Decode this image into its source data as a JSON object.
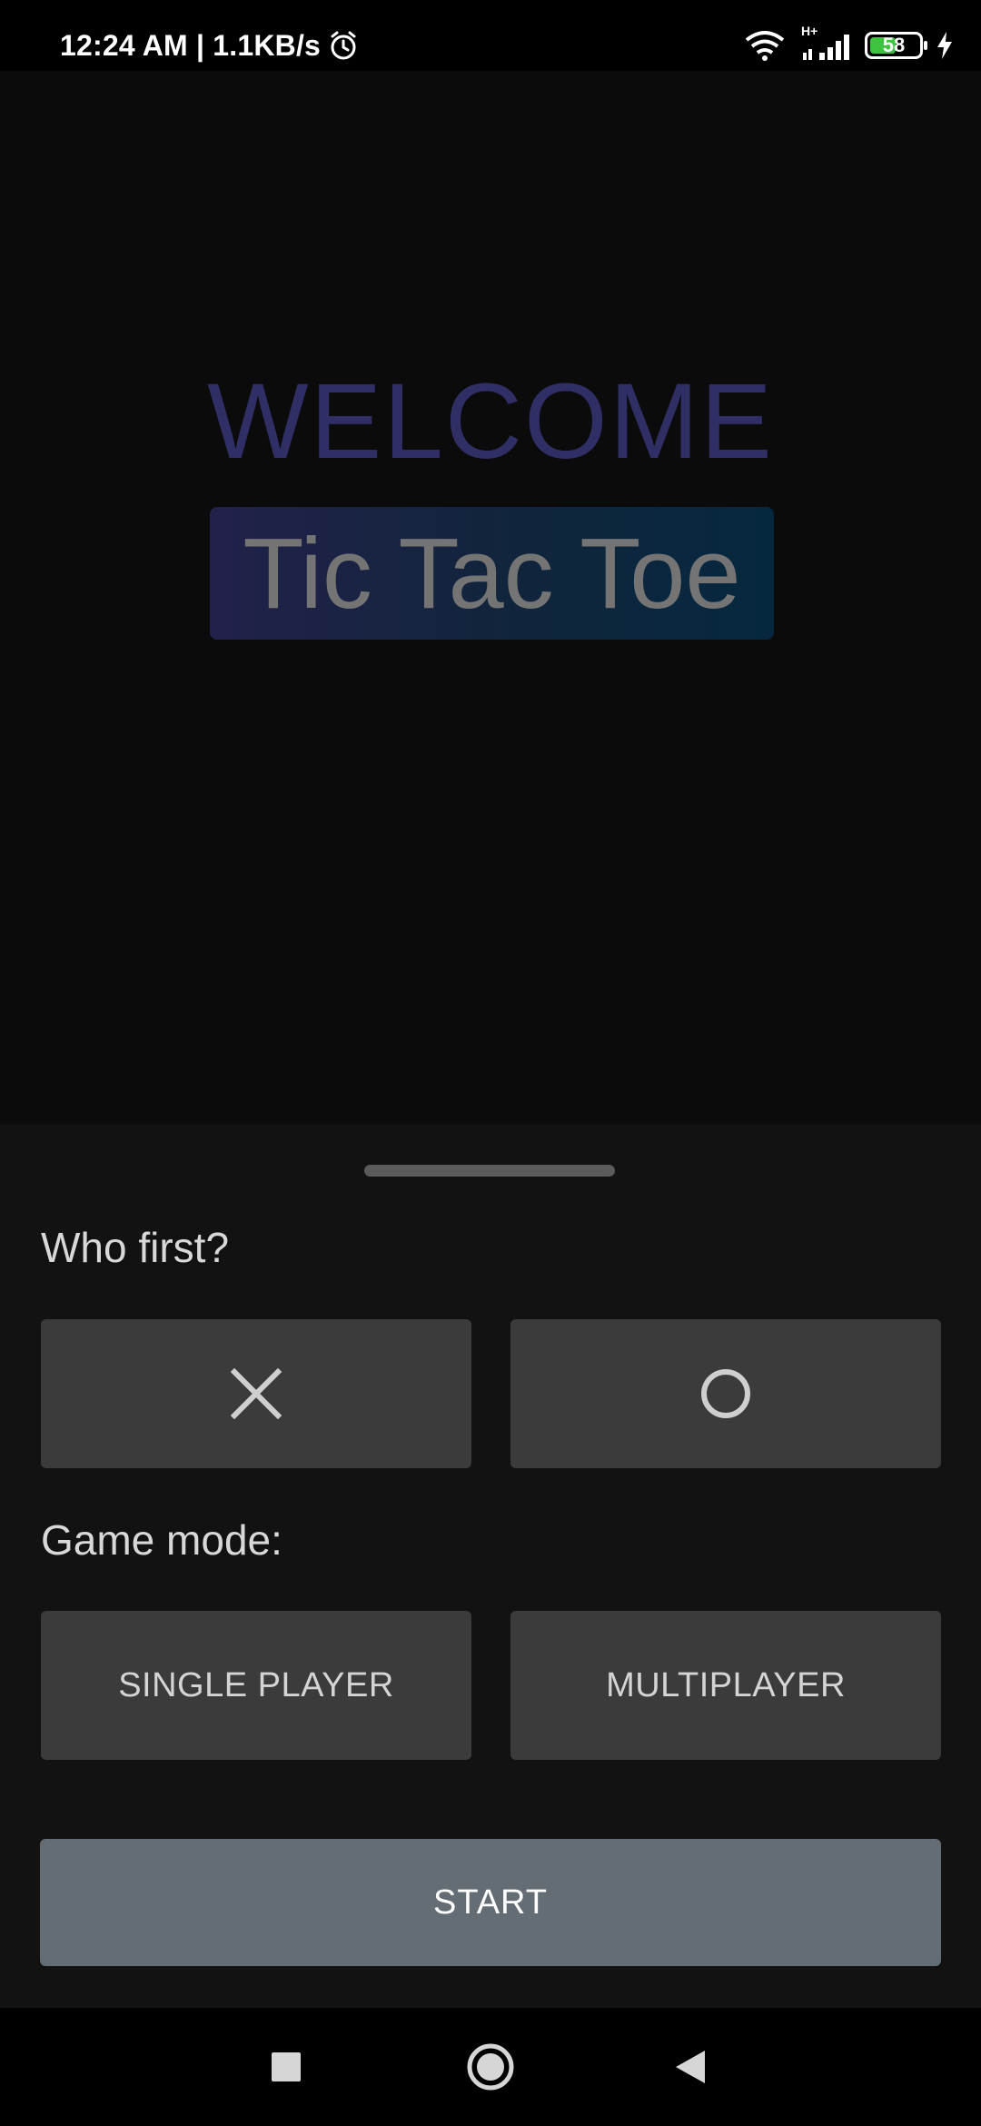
{
  "status_bar": {
    "time_speed": "12:24 AM | 1.1KB/s",
    "battery_level": "58",
    "battery_fill_percent": 58,
    "network_label": "H+",
    "icons": [
      "alarm-icon",
      "wifi-icon",
      "signal-icon",
      "battery-icon",
      "charging-icon"
    ]
  },
  "welcome": {
    "heading": "WELCOME",
    "title": "Tic Tac Toe"
  },
  "sheet": {
    "who_first_label": "Who first?",
    "first_options": [
      {
        "symbol": "X",
        "icon": "x-icon"
      },
      {
        "symbol": "O",
        "icon": "o-icon"
      }
    ],
    "game_mode_label": "Game mode:",
    "mode_options": [
      "SINGLE PLAYER",
      "MULTIPLAYER"
    ],
    "start_label": "START"
  },
  "nav_bar": {
    "icons": [
      "recents-square-icon",
      "home-circle-icon",
      "back-triangle-icon"
    ]
  },
  "colors": {
    "welcome_text": "#2f2f66",
    "title_gradient_start": "#22214a",
    "title_gradient_end": "#06283f",
    "option_button_bg": "#3b3b3b",
    "start_button_bg": "#636d73",
    "battery_fill": "#3ec33e"
  }
}
